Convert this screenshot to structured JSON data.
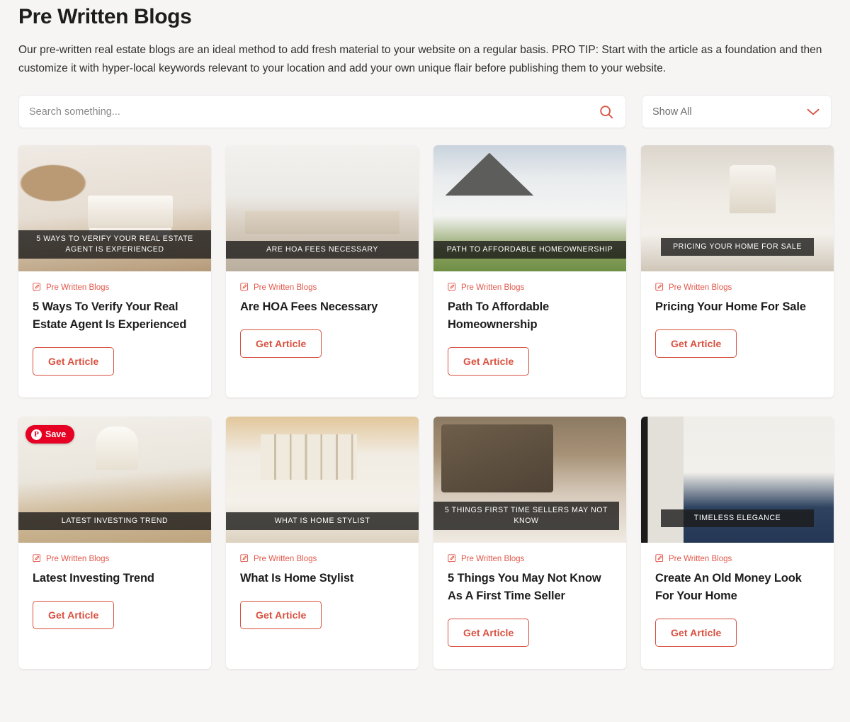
{
  "header": {
    "title": "Pre Written Blogs",
    "description": "Our pre-written real estate blogs are an ideal method to add fresh material to your website on a regular basis. PRO TIP: Start with the article as a foundation and then customize it with hyper-local keywords relevant to your location and add your own unique flair before publishing them to your website."
  },
  "filters": {
    "search": {
      "value": "",
      "placeholder": "Search something...",
      "icon": "search-icon"
    },
    "dropdown": {
      "selected": "Show All",
      "icon": "chevron-down-icon"
    }
  },
  "accent_colors": {
    "red": "#d9503f",
    "category_red": "#e2584a",
    "pinterest_red": "#e60023",
    "title_dark": "#1d1d1d",
    "page_background": "#f6f5f4",
    "card_background": "#ffffff",
    "overlay": "rgba(28,26,25,0.80)"
  },
  "cards": [
    {
      "overlay_caption": "5 Ways To Verify Your Real Estate Agent Is Experienced",
      "category": "Pre Written Blogs",
      "category_icon": "edit-pen-icon",
      "title": "5 Ways To Verify Your Real Estate Agent Is Experienced",
      "button": "Get Article",
      "save_badge": null
    },
    {
      "overlay_caption": "Are HOA Fees Necessary",
      "category": "Pre Written Blogs",
      "category_icon": "edit-pen-icon",
      "title": "Are HOA Fees Necessary",
      "button": "Get Article",
      "save_badge": null
    },
    {
      "overlay_caption": "Path To Affordable Homeownership",
      "category": "Pre Written Blogs",
      "category_icon": "edit-pen-icon",
      "title": "Path To Affordable Homeownership",
      "button": "Get Article",
      "save_badge": null
    },
    {
      "overlay_caption": "Pricing Your Home For Sale",
      "category": "Pre Written Blogs",
      "category_icon": "edit-pen-icon",
      "title": "Pricing Your Home For Sale",
      "button": "Get Article",
      "save_badge": null
    },
    {
      "overlay_caption": "Latest Investing Trend",
      "category": "Pre Written Blogs",
      "category_icon": "edit-pen-icon",
      "title": "Latest Investing Trend",
      "button": "Get Article",
      "save_badge": "Save"
    },
    {
      "overlay_caption": "What Is Home Stylist",
      "category": "Pre Written Blogs",
      "category_icon": "edit-pen-icon",
      "title": "What Is Home Stylist",
      "button": "Get Article",
      "save_badge": null
    },
    {
      "overlay_caption": "5 Things First Time Sellers May Not Know",
      "category": "Pre Written Blogs",
      "category_icon": "edit-pen-icon",
      "title": "5 Things You May Not Know As A First Time Seller",
      "button": "Get Article",
      "save_badge": null
    },
    {
      "overlay_caption": "Timeless Elegance",
      "category": "Pre Written Blogs",
      "category_icon": "edit-pen-icon",
      "title": "Create An Old Money Look For Your Home",
      "button": "Get Article",
      "save_badge": null
    }
  ]
}
